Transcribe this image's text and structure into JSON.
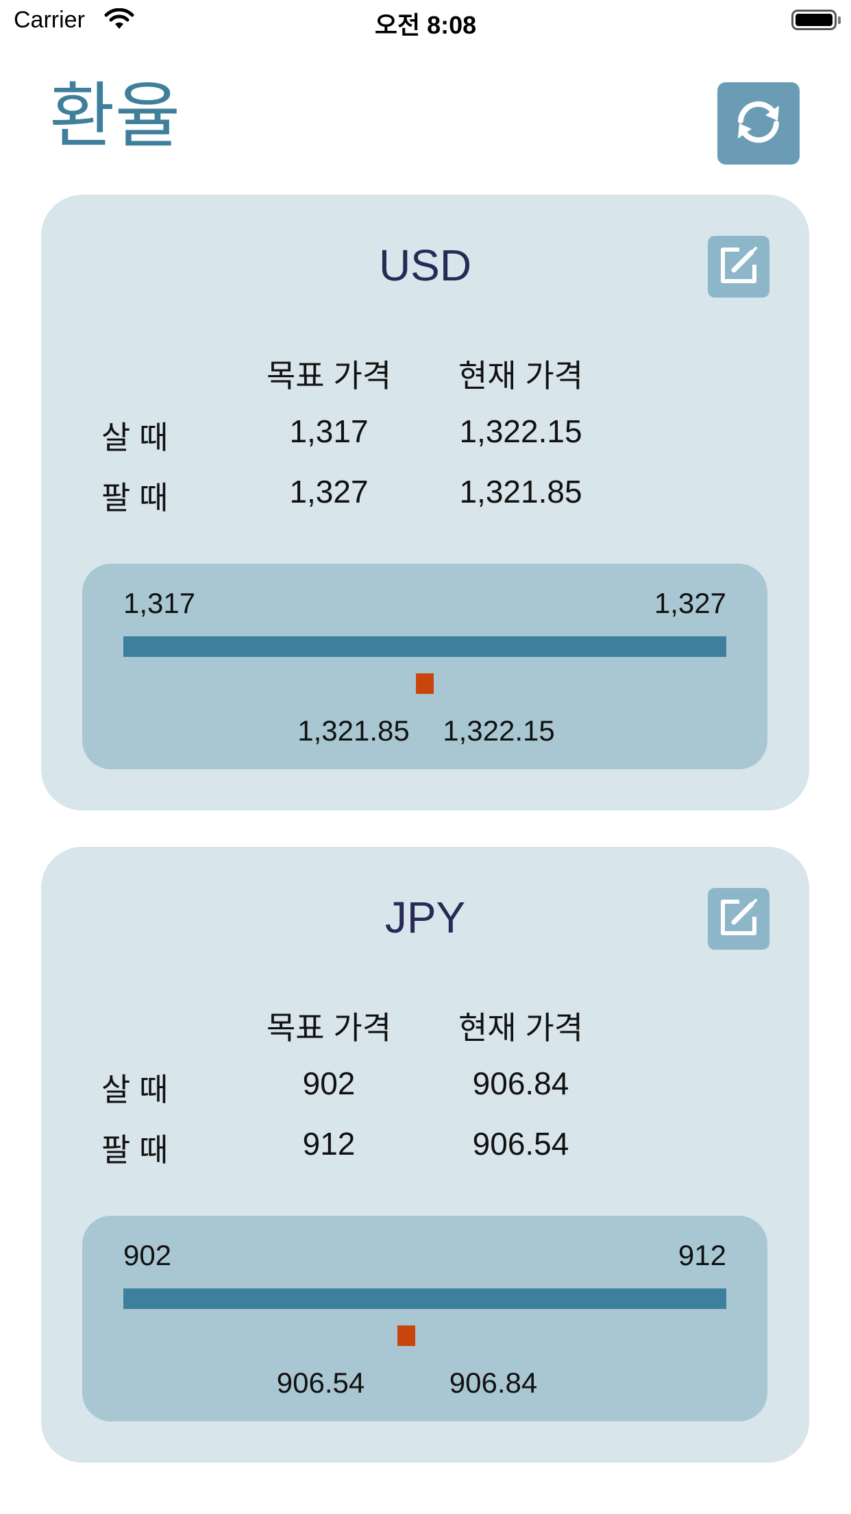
{
  "status_bar": {
    "carrier": "Carrier",
    "time": "오전 8:08"
  },
  "header": {
    "title": "환율",
    "refresh_icon": "refresh-icon"
  },
  "cards": [
    {
      "currency": "USD",
      "header_target": "목표 가격",
      "header_current": "현재 가격",
      "buy_label": "살 때",
      "sell_label": "팔 때",
      "buy_target": "1,317",
      "buy_current": "1,322.15",
      "sell_target": "1,327",
      "sell_current": "1,321.85",
      "range_min": "1,317",
      "range_max": "1,327",
      "marker_position": 0.5,
      "marker_label_left": "1,321.85",
      "marker_label_right": "1,322.15"
    },
    {
      "currency": "JPY",
      "header_target": "목표 가격",
      "header_current": "현재 가격",
      "buy_label": "살 때",
      "sell_label": "팔 때",
      "buy_target": "902",
      "buy_current": "906.84",
      "sell_target": "912",
      "sell_current": "906.54",
      "range_min": "902",
      "range_max": "912",
      "marker_position": 0.469,
      "marker_label_left": "906.54",
      "marker_label_right": "906.84"
    }
  ],
  "colors": {
    "accent": "#3f7f9b",
    "card_background": "#d8e5eb",
    "range_panel": "#a9c7d3",
    "range_track": "#3e7f9d",
    "marker": "#c8460e"
  }
}
